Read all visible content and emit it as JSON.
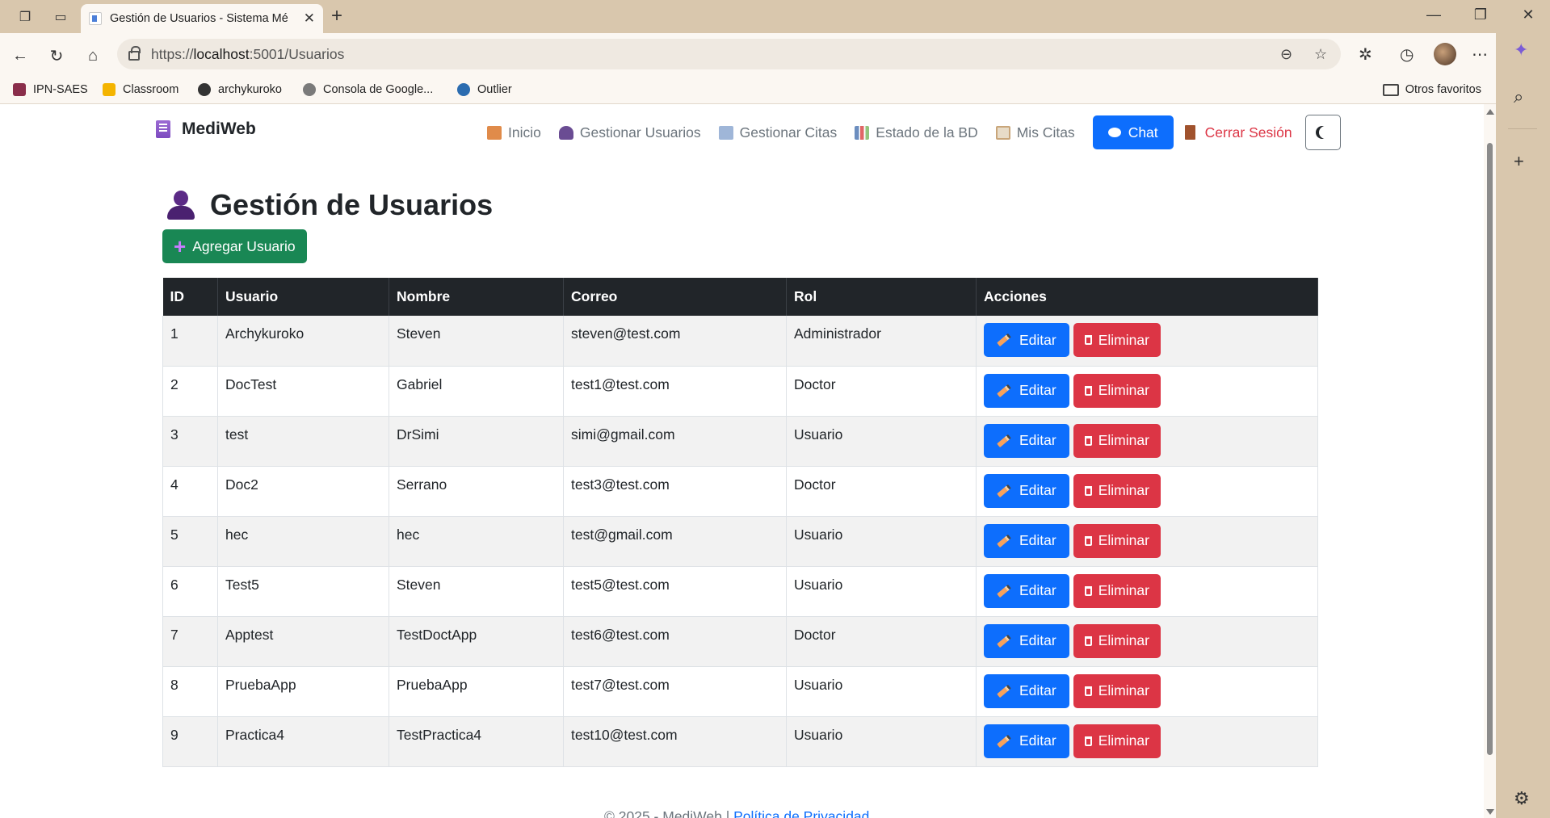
{
  "browser": {
    "tab_title": "Gestión de Usuarios - Sistema Mé",
    "url_prefix": "https://",
    "url_host": "localhost",
    "url_rest": ":5001/Usuarios",
    "bookmarks": [
      {
        "label": "IPN-SAES",
        "color": "#8a2e4b"
      },
      {
        "label": "Classroom",
        "color": "#f4b400"
      },
      {
        "label": "archykuroko",
        "color": "#333333"
      },
      {
        "label": "Consola de Google...",
        "color": "#7a7a7a"
      },
      {
        "label": "Outlier",
        "color": "#2b6cb0"
      }
    ],
    "other_favorites": "Otros favoritos"
  },
  "app": {
    "brand": "MediWeb",
    "nav": [
      {
        "label": "Inicio",
        "icon": "house-icon",
        "color": "#e08b4a"
      },
      {
        "label": "Gestionar Usuarios",
        "icon": "user-icon",
        "color": "#6a4c93"
      },
      {
        "label": "Gestionar Citas",
        "icon": "calendar-icon",
        "color": "#9fb6d8"
      },
      {
        "label": "Estado de la BD",
        "icon": "bar-chart-icon",
        "color": "#6c8ebf"
      },
      {
        "label": "Mis Citas",
        "icon": "clipboard-icon",
        "color": "#c9a67a"
      }
    ],
    "chat_label": "Chat",
    "logout_label": "Cerrar Sesión"
  },
  "page": {
    "title": "Gestión de Usuarios",
    "add_button": "Agregar Usuario",
    "columns": [
      "ID",
      "Usuario",
      "Nombre",
      "Correo",
      "Rol",
      "Acciones"
    ],
    "rows": [
      {
        "id": "1",
        "user": "Archykuroko",
        "name": "Steven",
        "email": "steven@test.com",
        "role": "Administrador"
      },
      {
        "id": "2",
        "user": "DocTest",
        "name": "Gabriel",
        "email": "test1@test.com",
        "role": "Doctor"
      },
      {
        "id": "3",
        "user": "test",
        "name": "DrSimi",
        "email": "simi@gmail.com",
        "role": "Usuario"
      },
      {
        "id": "4",
        "user": "Doc2",
        "name": "Serrano",
        "email": "test3@test.com",
        "role": "Doctor"
      },
      {
        "id": "5",
        "user": "hec",
        "name": "hec",
        "email": "test@gmail.com",
        "role": "Usuario"
      },
      {
        "id": "6",
        "user": "Test5",
        "name": "Steven",
        "email": "test5@test.com",
        "role": "Usuario"
      },
      {
        "id": "7",
        "user": "Apptest",
        "name": "TestDoctApp",
        "email": "test6@test.com",
        "role": "Doctor"
      },
      {
        "id": "8",
        "user": "PruebaApp",
        "name": "PruebaApp",
        "email": "test7@test.com",
        "role": "Usuario"
      },
      {
        "id": "9",
        "user": "Practica4",
        "name": "TestPractica4",
        "email": "test10@test.com",
        "role": "Usuario"
      }
    ],
    "edit_label": "Editar",
    "delete_label": "Eliminar",
    "footer_text": "© 2025 - MediWeb | ",
    "footer_link": "Política de Privacidad"
  }
}
